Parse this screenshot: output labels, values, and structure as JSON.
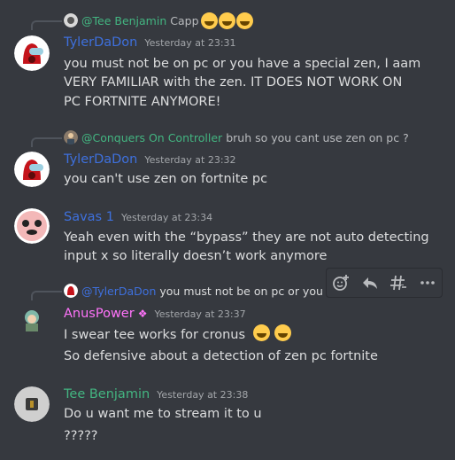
{
  "messages": [
    {
      "reply": {
        "user": "@Tee Benjamin",
        "user_color": "#43b581",
        "text": "Capp"
      },
      "author": "TylerDaDon",
      "author_color": "#3e70dd",
      "timestamp": "Yesterday at 23:31",
      "lines": [
        "you must not be on pc or you have a special zen, I aam",
        "VERY FAMILIAR with the zen. IT DOES NOT WORK ON",
        "PC FORTNITE ANYMORE!"
      ]
    },
    {
      "reply": {
        "user": "@Conquers On Controller",
        "user_color": "#43b581",
        "text": "bruh so you cant use zen on pc ?"
      },
      "author": "TylerDaDon",
      "author_color": "#3e70dd",
      "timestamp": "Yesterday at 23:32",
      "lines": [
        "you can't use zen on fortnite pc"
      ]
    },
    {
      "author": "Savas 1",
      "author_color": "#3e70dd",
      "timestamp": "Yesterday at 23:34",
      "lines": [
        "Yeah even with the “bypass” they are not auto detecting",
        "input x so literally doesn’t work anymore"
      ]
    },
    {
      "reply": {
        "user": "@TylerDaDon",
        "user_color": "#3e70dd",
        "text": "you must not be on pc or you have"
      },
      "author": "AnusPower",
      "author_color": "#ff73fa",
      "timestamp": "Yesterday at 23:37",
      "lines": [
        "I swear tee works for cronus",
        "So defensive about a detection of zen pc fortnite"
      ],
      "avatar_caption": "ANUSPOWER"
    },
    {
      "author": "Tee Benjamin",
      "author_color": "#43b581",
      "timestamp": "Yesterday at 23:38",
      "lines": [
        "Do u want me to stream it to u",
        "?????"
      ]
    }
  ],
  "toolbar": {
    "icons": [
      "add-reaction-icon",
      "reply-icon",
      "create-thread-icon",
      "more-icon"
    ]
  },
  "colors": {
    "background": "#36393f",
    "text": "#dcddde",
    "timestamp": "#a3a6aa"
  }
}
